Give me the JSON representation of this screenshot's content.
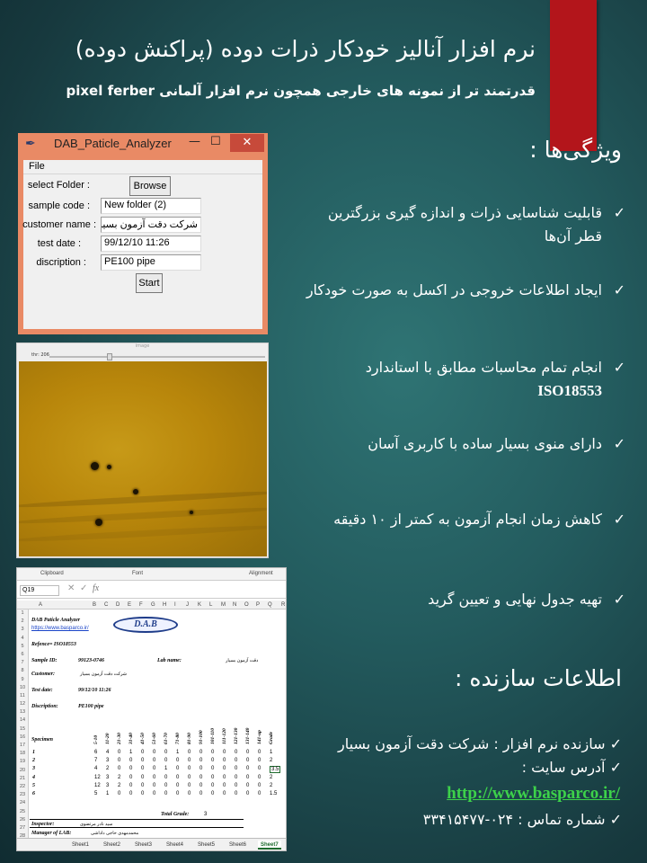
{
  "header": {
    "title": "نرم افزار آنالیز خودکار ذرات دوده (پراکنش دوده)",
    "subtitle": "قدرتمند تر از نمونه های خارجی همچون نرم افزار آلمانی pixel ferber"
  },
  "dialog": {
    "title": "DAB_Paticle_Analyzer",
    "menu_file": "File",
    "minimize": "—",
    "maximize": "☐",
    "close": "✕",
    "select_folder_label": "select Folder :",
    "browse_label": "Browse",
    "sample_code_label": "sample code :",
    "sample_code_value": "New folder (2)",
    "customer_name_label": "customer name :",
    "customer_name_value": "شرکت دقت آزمون بسیار",
    "test_date_label": "test date :",
    "test_date_value": "99/12/10  11:26",
    "discription_label": "discription :",
    "discription_value": "PE100 pipe",
    "start_label": "Start"
  },
  "image_window": {
    "title": "image",
    "slider_label": "thr: 206"
  },
  "excel": {
    "ribbon": {
      "clipboard": "Clipboard",
      "font": "Font",
      "alignment": "Alignment"
    },
    "name_box": "Q19",
    "fx": "fx",
    "cancel": "✕",
    "confirm": "✓",
    "columns": [
      "A",
      "B",
      "C",
      "D",
      "E",
      "F",
      "G",
      "H",
      "I",
      "J",
      "K",
      "L",
      "M",
      "N",
      "O",
      "P",
      "Q",
      "R"
    ],
    "rows": [
      "1",
      "2",
      "3",
      "4",
      "5",
      "6",
      "7",
      "8",
      "9",
      "10",
      "11",
      "12",
      "13",
      "14",
      "15",
      "16",
      "17",
      "18",
      "19",
      "20",
      "21",
      "22",
      "23",
      "24",
      "25",
      "26",
      "27",
      "28"
    ],
    "app_name": "DAB Paticle Analyzer",
    "site": "https://www.basparco.ir/",
    "logo": "D.A.B",
    "reference": "Refence= ISO18553",
    "sample_id_label": "Sample ID:",
    "sample_id_value": "99123-0746",
    "lab_name_label": "Lab name:",
    "lab_name_value": "دقت آزمون بسیار",
    "customer_label": "Customer:",
    "customer_value": "شرکت دقت آزمون بسیار",
    "test_date_label": "Test date:",
    "test_date_value": "99/12/10  11:26",
    "discription_label": "Discription:",
    "discription_value": "PE100 pipe",
    "specimen_label": "Specimen",
    "bins": [
      "5-10",
      "11-20",
      "21-30",
      "31-40",
      "41-50",
      "51-60",
      "61-70",
      "71-80",
      "81-90",
      "91-100",
      "101-110",
      "111-120",
      "121-130",
      "131-140",
      "141-up",
      "Grade"
    ],
    "table_rows": [
      {
        "id": "1",
        "vals": [
          "6",
          "4",
          "0",
          "1",
          "0",
          "0",
          "0",
          "1",
          "0",
          "0",
          "0",
          "0",
          "0",
          "0",
          "0",
          "1"
        ]
      },
      {
        "id": "2",
        "vals": [
          "7",
          "3",
          "0",
          "0",
          "0",
          "0",
          "0",
          "0",
          "0",
          "0",
          "0",
          "0",
          "0",
          "0",
          "0",
          "2"
        ]
      },
      {
        "id": "3",
        "vals": [
          "4",
          "2",
          "0",
          "0",
          "0",
          "0",
          "1",
          "0",
          "0",
          "0",
          "0",
          "0",
          "0",
          "0",
          "0",
          "3.5"
        ]
      },
      {
        "id": "4",
        "vals": [
          "12",
          "3",
          "2",
          "0",
          "0",
          "0",
          "0",
          "0",
          "0",
          "0",
          "0",
          "0",
          "0",
          "0",
          "0",
          "2"
        ]
      },
      {
        "id": "5",
        "vals": [
          "12",
          "3",
          "2",
          "0",
          "0",
          "0",
          "0",
          "0",
          "0",
          "0",
          "0",
          "0",
          "0",
          "0",
          "0",
          "2"
        ]
      },
      {
        "id": "6",
        "vals": [
          "5",
          "1",
          "0",
          "0",
          "0",
          "0",
          "0",
          "0",
          "0",
          "0",
          "0",
          "0",
          "0",
          "0",
          "0",
          "1.5"
        ]
      }
    ],
    "total_grade_label": "Total Grade:",
    "total_grade_value": "3",
    "inspector_label": "Inspector:",
    "inspector_value": "سید نادر مرتضوی",
    "manager_label": "Manager of LAB:",
    "manager_value": "محمدمهدی حاجی داداشی",
    "sheets": [
      "Sheet1",
      "Sheet2",
      "Sheet3",
      "Sheet4",
      "Sheet5",
      "Sheet6",
      "Sheet7"
    ],
    "active_sheet": "Sheet7"
  },
  "features": {
    "heading": "ویژگی‌ها :",
    "items": [
      "قابلیت شناسایی ذرات و اندازه گیری بزرگترین قطر آن‌ها",
      "ایجاد اطلاعات خروجی در اکسل به صورت خودکار",
      "انجام تمام محاسبات مطابق با استاندارد",
      "دارای منوی بسیار ساده با کاربری آسان",
      "کاهش زمان انجام آزمون به کمتر از ۱۰ دقیقه",
      "تهیه جدول نهایی و تعیین گرید"
    ],
    "iso": "ISO18553"
  },
  "maker": {
    "heading": "اطلاعات سازنده :",
    "company": "سازنده نرم افزار : شرکت دقت آزمون بسیار",
    "site_label": "آدرس سایت :",
    "url": "http://www.basparco.ir/",
    "phone": "شماره تماس : ۰۲۴-۳۳۴۱۵۴۷۷"
  },
  "colors": {
    "accent_red": "#b3151b",
    "link_green": "#3dd24a",
    "background": "#235b5e",
    "window_frame": "#e98a65"
  },
  "icons": [
    "feather-icon",
    "check-icon",
    "fx-icon"
  ]
}
